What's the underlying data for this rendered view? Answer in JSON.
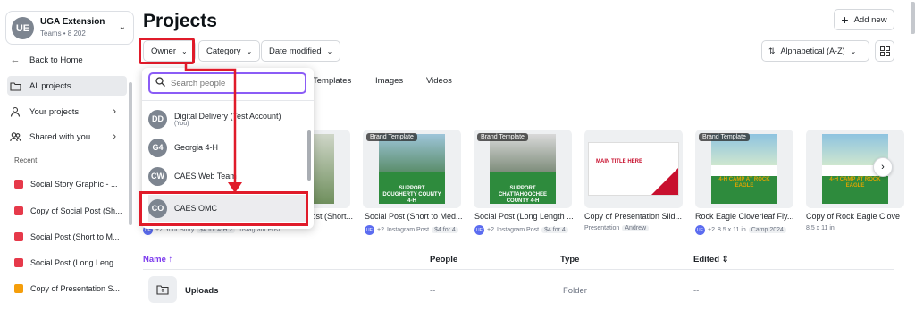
{
  "team": {
    "avatar": "UE",
    "name": "UGA Extension",
    "sub": "Teams • 8 202"
  },
  "sidebar": {
    "items": [
      {
        "label": "Back to Home",
        "icon": "arrow-left-icon"
      },
      {
        "label": "All projects",
        "icon": "folder-icon"
      },
      {
        "label": "Your projects",
        "icon": "person-icon"
      },
      {
        "label": "Shared with you",
        "icon": "people-icon"
      }
    ],
    "recent_label": "Recent",
    "recent": [
      {
        "label": "Social Story Graphic - ...",
        "color": "#e6394a"
      },
      {
        "label": "Copy of Social Post (Sh...",
        "color": "#e6394a"
      },
      {
        "label": "Social Post (Short to M...",
        "color": "#e6394a"
      },
      {
        "label": "Social Post (Long Leng...",
        "color": "#e6394a"
      },
      {
        "label": "Copy of Presentation S...",
        "color": "#f59e0b"
      }
    ]
  },
  "header": {
    "title": "Projects",
    "add_new": "Add new"
  },
  "filters": {
    "owner": "Owner",
    "category": "Category",
    "date": "Date modified"
  },
  "sort": {
    "label": "Alphabetical (A-Z)"
  },
  "type_tabs": [
    "Templates",
    "Images",
    "Videos"
  ],
  "owner_dropdown": {
    "search_placeholder": "Search people",
    "people": [
      {
        "initials": "DD",
        "name": "Digital Delivery (Test Account)",
        "sub": "(You)"
      },
      {
        "initials": "G4",
        "name": "Georgia 4-H",
        "sub": ""
      },
      {
        "initials": "CW",
        "name": "CAES Web Team",
        "sub": ""
      },
      {
        "initials": "CO",
        "name": "CAES OMC",
        "sub": ""
      }
    ]
  },
  "cards": [
    {
      "title": "Copy of Social Post (Short...",
      "badge": "",
      "meta_user": "+2",
      "meta_type": "Your Story",
      "meta_chip": "$4 for 4-H 2",
      "meta_extra": "Instagram Post",
      "thumb_text": "",
      "accent": "#3f8f45"
    },
    {
      "title": "Social Post (Short to Med...",
      "badge": "Brand Template",
      "meta_user": "+2",
      "meta_type": "Instagram Post",
      "meta_chip": "$4 for 4",
      "meta_extra": "",
      "thumb_text": "SUPPORT DOUGHERTY COUNTY 4-H",
      "accent": "#2e8b3d"
    },
    {
      "title": "Social Post (Long Length ...",
      "badge": "Brand Template",
      "meta_user": "+2",
      "meta_type": "Instagram Post",
      "meta_chip": "$4 for 4",
      "meta_extra": "",
      "thumb_text": "SUPPORT CHATTAHOOCHEE COUNTY 4-H",
      "accent": "#2e8b3d"
    },
    {
      "title": "Copy of Presentation Slid...",
      "badge": "",
      "meta_user": "",
      "meta_type": "Presentation",
      "meta_chip": "Andrew",
      "meta_extra": "",
      "thumb_text": "MAIN TITLE HERE",
      "accent": "#c8102e"
    },
    {
      "title": "Rock Eagle Cloverleaf Fly...",
      "badge": "Brand Template",
      "meta_user": "+2",
      "meta_type": "8.5 x 11 in",
      "meta_chip": "Camp 2024",
      "meta_extra": "",
      "thumb_text": "4-H CAMP AT ROCK EAGLE",
      "accent": "#2e8b3d"
    },
    {
      "title": "Copy of Rock Eagle Clove",
      "badge": "",
      "meta_user": "",
      "meta_type": "8.5 x 11 in",
      "meta_chip": "",
      "meta_extra": "",
      "thumb_text": "4-H CAMP AT ROCK EAGLE",
      "accent": "#2e8b3d"
    }
  ],
  "table": {
    "headers": {
      "name": "Name ↑",
      "people": "People",
      "type": "Type",
      "edited": "Edited"
    },
    "rows": [
      {
        "name": "Uploads",
        "people": "--",
        "type": "Folder",
        "edited": "--"
      }
    ]
  }
}
